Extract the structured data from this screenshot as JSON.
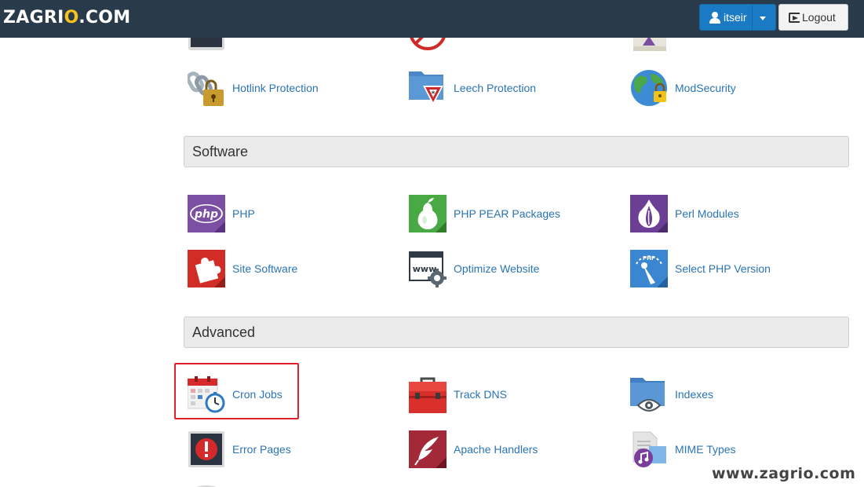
{
  "header": {
    "logo_main": "ZAGRI",
    "logo_o": "O",
    "logo_tail": ".COM",
    "user_label": "itseir",
    "logout_label": "Logout"
  },
  "rows": {
    "security": [
      {
        "label": "Hotlink Protection",
        "icon": "chain-lock-icon"
      },
      {
        "label": "Leech Protection",
        "icon": "folder-warning-icon"
      },
      {
        "label": "ModSecurity",
        "icon": "globe-lock-icon"
      }
    ]
  },
  "sections": {
    "software": {
      "title": "Software",
      "items": [
        {
          "label": "PHP",
          "icon": "php-icon"
        },
        {
          "label": "PHP PEAR Packages",
          "icon": "pear-icon"
        },
        {
          "label": "Perl Modules",
          "icon": "onion-icon"
        },
        {
          "label": "Site Software",
          "icon": "puzzle-icon"
        },
        {
          "label": "Optimize Website",
          "icon": "www-gear-icon"
        },
        {
          "label": "Select PHP Version",
          "icon": "php-gauge-icon"
        }
      ]
    },
    "advanced": {
      "title": "Advanced",
      "items": [
        {
          "label": "Cron Jobs",
          "icon": "calendar-clock-icon"
        },
        {
          "label": "Track DNS",
          "icon": "toolbox-icon"
        },
        {
          "label": "Indexes",
          "icon": "folder-eye-icon"
        },
        {
          "label": "Error Pages",
          "icon": "error-page-icon"
        },
        {
          "label": "Apache Handlers",
          "icon": "feather-icon"
        },
        {
          "label": "MIME Types",
          "icon": "music-file-icon"
        }
      ]
    }
  },
  "icon_text": {
    "php": "php",
    "www": "www",
    "gauge": "PHP"
  },
  "colors": {
    "topbar": "#293a4a",
    "accent": "#1a7bc4",
    "link": "#2a74b5",
    "highlight": "#e0202a"
  },
  "watermark": "www.zagrio.com"
}
